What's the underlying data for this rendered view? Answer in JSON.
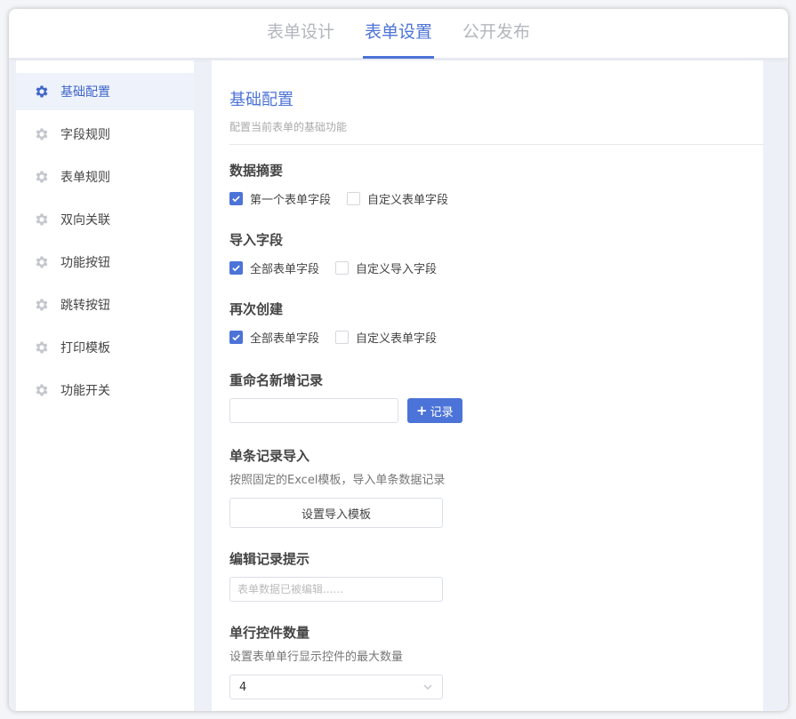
{
  "tabs": [
    {
      "label": "表单设计"
    },
    {
      "label": "表单设置"
    },
    {
      "label": "公开发布"
    }
  ],
  "sidebar": {
    "items": [
      {
        "label": "基础配置"
      },
      {
        "label": "字段规则"
      },
      {
        "label": "表单规则"
      },
      {
        "label": "双向关联"
      },
      {
        "label": "功能按钮"
      },
      {
        "label": "跳转按钮"
      },
      {
        "label": "打印模板"
      },
      {
        "label": "功能开关"
      }
    ]
  },
  "main": {
    "title": "基础配置",
    "subtitle": "配置当前表单的基础功能",
    "data_summary": {
      "title": "数据摘要",
      "options": [
        {
          "label": "第一个表单字段",
          "checked": true
        },
        {
          "label": "自定义表单字段",
          "checked": false
        }
      ]
    },
    "import_fields": {
      "title": "导入字段",
      "options": [
        {
          "label": "全部表单字段",
          "checked": true
        },
        {
          "label": "自定义导入字段",
          "checked": false
        }
      ]
    },
    "recreate": {
      "title": "再次创建",
      "options": [
        {
          "label": "全部表单字段",
          "checked": true
        },
        {
          "label": "自定义表单字段",
          "checked": false
        }
      ]
    },
    "rename_record": {
      "title": "重命名新增记录",
      "input_value": "",
      "button_label": "记录"
    },
    "single_import": {
      "title": "单条记录导入",
      "desc": "按照固定的Excel模板，导入单条数据记录",
      "button_label": "设置导入模板"
    },
    "edit_tip": {
      "title": "编辑记录提示",
      "placeholder": "表单数据已被编辑......"
    },
    "row_controls": {
      "title": "单行控件数量",
      "desc": "设置表单单行显示控件的最大数量",
      "selected": "4"
    }
  },
  "colors": {
    "accent": "#4c73d8",
    "active_bg": "#eef2fb"
  },
  "icons": {
    "sidebar": "gear-icon",
    "check": "check-icon",
    "plus": "plus-icon",
    "select": "chevron-down-icon"
  }
}
